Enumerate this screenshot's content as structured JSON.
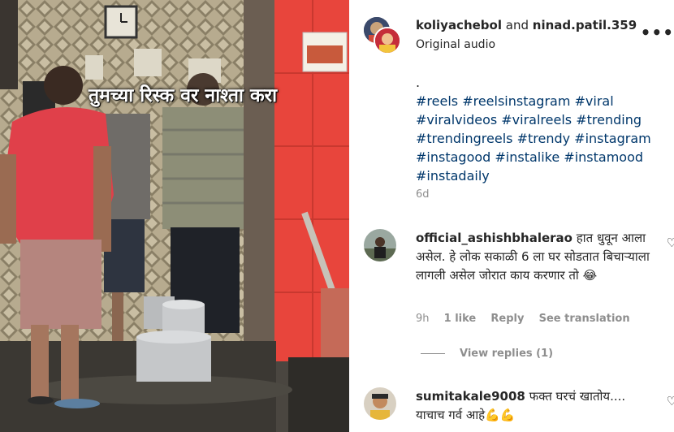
{
  "video": {
    "caption": "तुमच्या रिस्क वर नाश्ता करा"
  },
  "post": {
    "author_primary": "koliyachebol",
    "joiner": " and ",
    "author_secondary": "ninad.patil.359",
    "audio": "Original audio",
    "more_icon": "more-horizontal-icon",
    "description_dot": ".",
    "description_tags": "#reels #reelsinstagram #viral #viralvideos #viralreels #trending #trendingreels #trendy #instagram #instagood #instalike #instamood #instadaily",
    "age": "6d"
  },
  "comments": [
    {
      "username": "official_ashishbhalerao",
      "text": "हात धुवून आला असेल. हे लोक सकाळी 6 ला घर सोडतात बिचाऱ्याला लागली असेल जोरात काय करणार तो 😂",
      "time": "9h",
      "likes": "1 like",
      "reply": "Reply",
      "translate": "See translation",
      "view_replies": "View replies (1)"
    },
    {
      "username": "sumitakale9008",
      "text": "फक्त घरचं खातोय.... याचाच गर्व आहे💪💪"
    }
  ],
  "colors": {
    "text": "#262626",
    "secondary": "#8e8e8e",
    "hashtag": "#00376b",
    "wall_red": "#e8453c",
    "shirt_red": "#e0404a"
  }
}
